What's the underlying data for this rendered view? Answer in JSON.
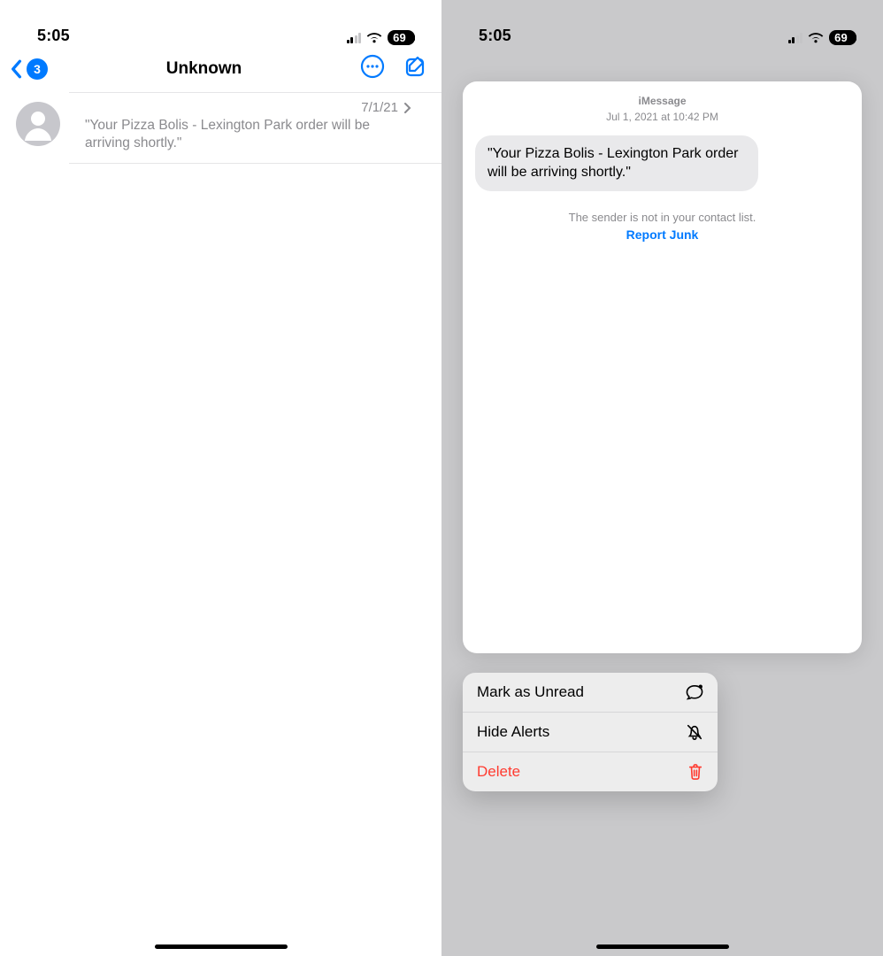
{
  "status": {
    "time": "5:05",
    "battery": "69"
  },
  "list": {
    "title": "Unknown",
    "badge": "3",
    "row_date": "7/1/21",
    "row_preview": "\"Your Pizza Bolis - Lexington Park order will be arriving shortly.\""
  },
  "preview": {
    "header_service": "iMessage",
    "header_datetime": "Jul 1, 2021 at 10:42 PM",
    "bubble_text": "\"Your Pizza Bolis - Lexington Park order will be arriving shortly.\"",
    "not_in_contacts": "The sender is not in your contact list.",
    "report_junk": "Report Junk"
  },
  "menu": {
    "unread": "Mark as Unread",
    "hide": "Hide Alerts",
    "delete": "Delete"
  }
}
